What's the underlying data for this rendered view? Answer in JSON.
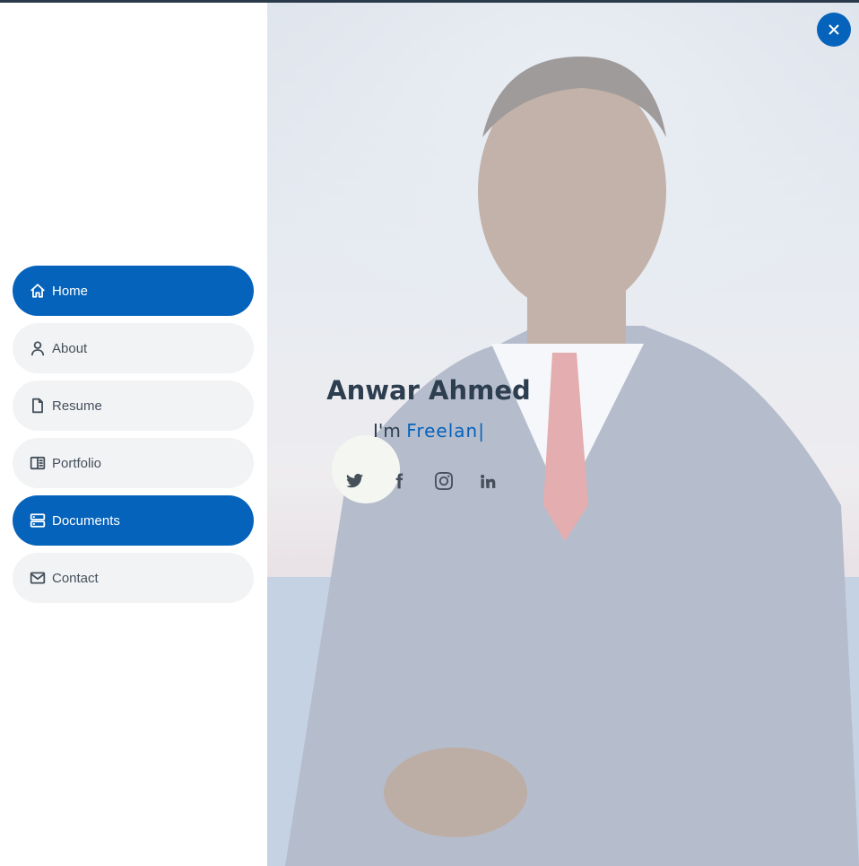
{
  "colors": {
    "accent": "#0563bb",
    "text": "#45505b",
    "heading": "#2d3e50",
    "nav_bg": "#f2f3f5"
  },
  "nav": {
    "items": [
      {
        "label": "Home",
        "icon": "home-icon",
        "active": true
      },
      {
        "label": "About",
        "icon": "user-icon",
        "active": false
      },
      {
        "label": "Resume",
        "icon": "file-icon",
        "active": false
      },
      {
        "label": "Portfolio",
        "icon": "book-half-icon",
        "active": false
      },
      {
        "label": "Documents",
        "icon": "server-icon",
        "active": true
      },
      {
        "label": "Contact",
        "icon": "envelope-icon",
        "active": false
      }
    ]
  },
  "hero": {
    "name": "Anwar Ahmed",
    "role_prefix": "I'm",
    "role_typed": "Freelan",
    "cursor": "|",
    "social": [
      "twitter-icon",
      "facebook-icon",
      "instagram-icon",
      "linkedin-icon"
    ]
  },
  "close_button": {
    "icon": "close-icon"
  }
}
